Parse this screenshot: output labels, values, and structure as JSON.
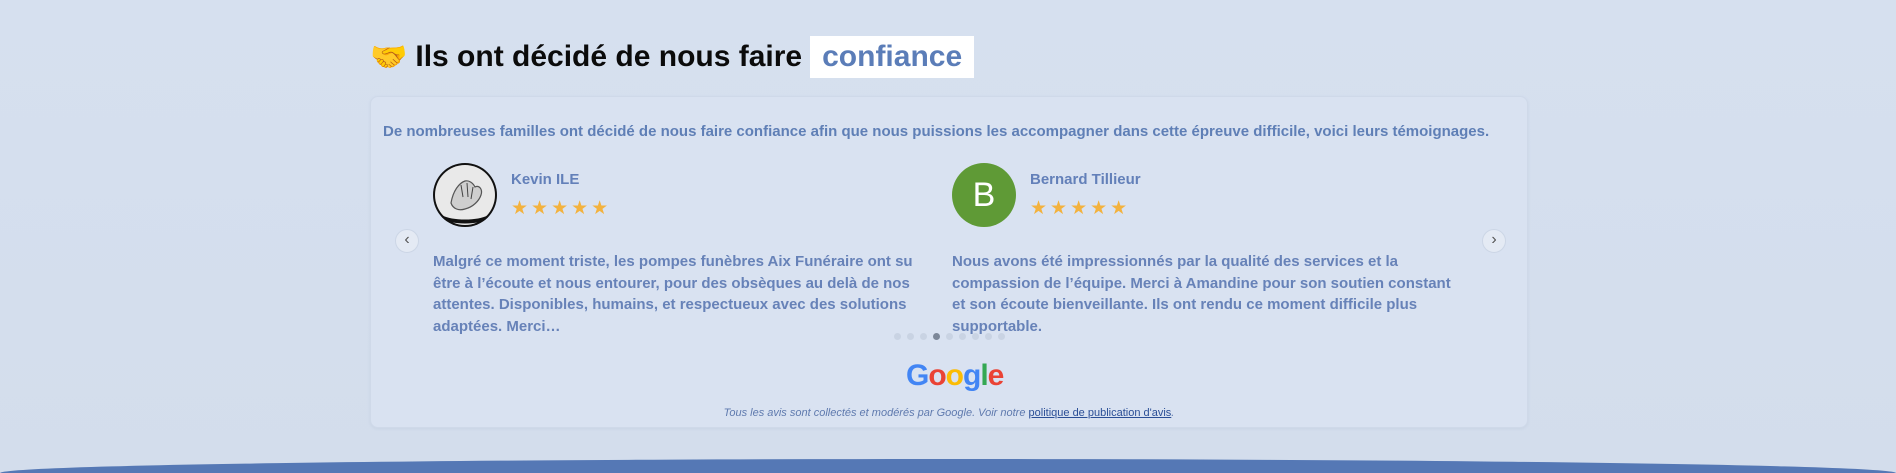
{
  "heading": {
    "icon": "handshake-icon",
    "text": "Ils ont décidé de nous faire",
    "highlight": "confiance"
  },
  "intro": "De nombreuses familles ont décidé de nous faire confiance afin que nous puissions les accompagner dans cette épreuve difficile, voici leurs témoignages.",
  "reviews": [
    {
      "name": "Kevin ILE",
      "stars": "★★★★★",
      "rating": 5,
      "text": "Malgré ce moment triste, les pompes funèbres Aix Funéraire ont su être à l’écoute et nous entourer, pour des obsèques au delà de nos attentes. Disponibles, humains, et respectueux avec des solutions adaptées. Merci…"
    },
    {
      "name": "Bernard Tillieur",
      "initial": "B",
      "stars": "★★★★★",
      "rating": 5,
      "text": "Nous avons été impressionnés par la qualité des services et la compassion de l’équipe. Merci à Amandine pour son soutien constant et son écoute bienveillante. Ils ont rendu ce moment difficile plus supportable."
    }
  ],
  "nav": {
    "prev": "‹",
    "next": "›"
  },
  "pagination": {
    "total": 9,
    "active": 4
  },
  "google_logo": [
    "G",
    "o",
    "o",
    "g",
    "l",
    "e"
  ],
  "footer": {
    "text": "Tous les avis sont collectés et modérés par Google. Voir notre ",
    "link": "politique de publication d'avis",
    "end": "."
  },
  "colors": {
    "background": "#d6e0ef",
    "accent": "#5b7db8",
    "star": "#f3b23e",
    "avatar_b": "#5f9a36"
  }
}
